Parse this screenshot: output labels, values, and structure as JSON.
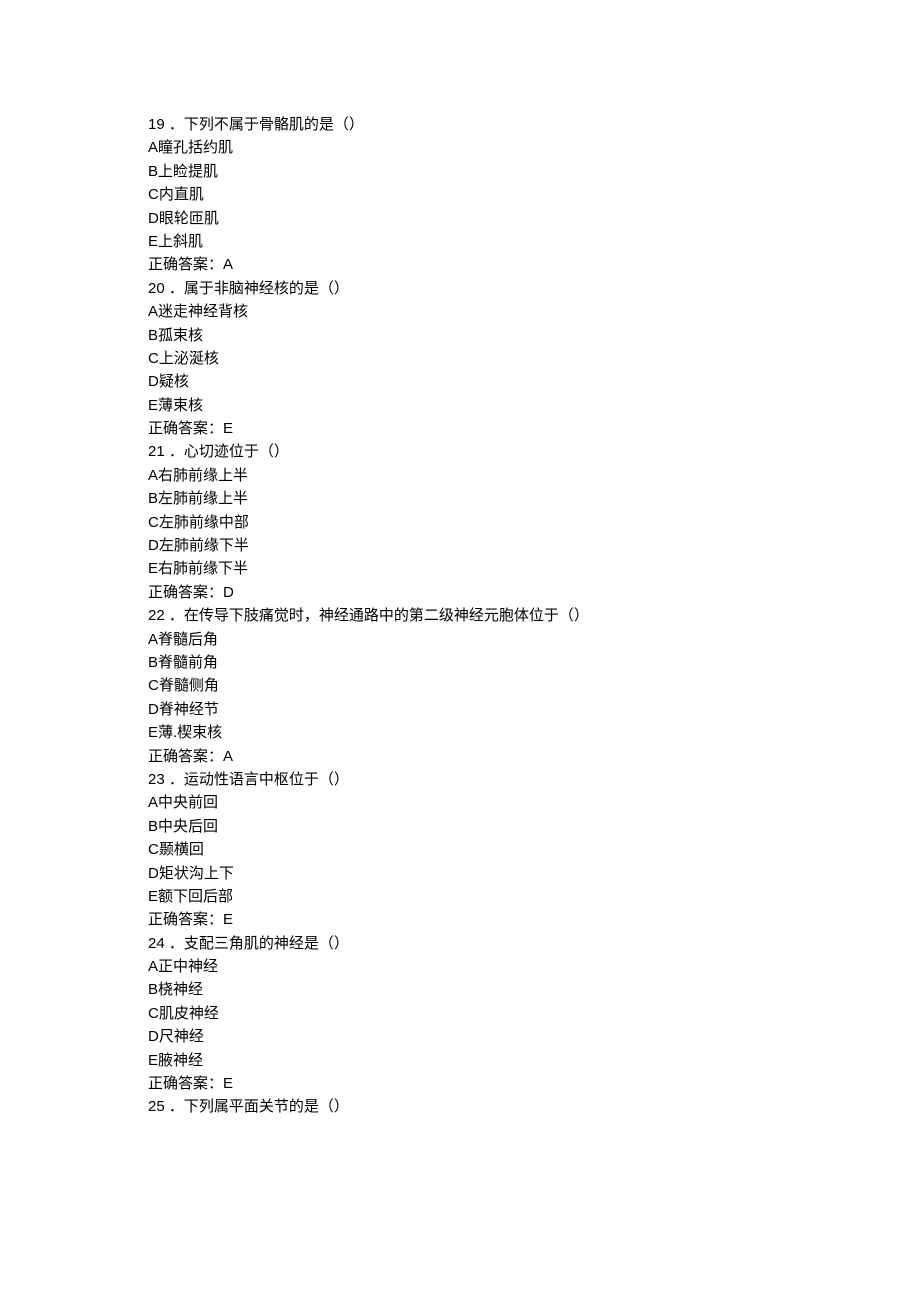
{
  "questions": [
    {
      "number": "19",
      "separator": " ．",
      "text": "下列不属于骨骼肌的是（）",
      "options": [
        {
          "label": "A",
          "text": "瞳孔括约肌"
        },
        {
          "label": "B",
          "text": "上睑提肌"
        },
        {
          "label": "C",
          "text": "内直肌"
        },
        {
          "label": "D",
          "text": "眼轮匝肌"
        },
        {
          "label": "E",
          "text": "上斜肌"
        }
      ],
      "answer_prefix": "正确答案：",
      "answer": "A"
    },
    {
      "number": "20",
      "separator": " ．",
      "text": "属于非脑神经核的是（）",
      "options": [
        {
          "label": "A",
          "text": "迷走神经背核"
        },
        {
          "label": "B",
          "text": "孤束核"
        },
        {
          "label": "C",
          "text": "上泌涎核"
        },
        {
          "label": "D",
          "text": "疑核"
        },
        {
          "label": "E",
          "text": "薄束核"
        }
      ],
      "answer_prefix": "正确答案：",
      "answer": "E"
    },
    {
      "number": "21",
      "separator": " ．",
      "text": "心切迹位于（）",
      "options": [
        {
          "label": "A",
          "text": "右肺前缘上半"
        },
        {
          "label": "B",
          "text": "左肺前缘上半"
        },
        {
          "label": "C",
          "text": "左肺前缘中部"
        },
        {
          "label": "D",
          "text": "左肺前缘下半"
        },
        {
          "label": "E",
          "text": "右肺前缘下半"
        }
      ],
      "answer_prefix": "正确答案：",
      "answer": "D"
    },
    {
      "number": "22",
      "separator": " ．",
      "text": "在传导下肢痛觉时，神经通路中的第二级神经元胞体位于（）",
      "options": [
        {
          "label": "A",
          "text": "脊髓后角"
        },
        {
          "label": "B",
          "text": "脊髓前角"
        },
        {
          "label": "C",
          "text": "脊髓侧角"
        },
        {
          "label": "D",
          "text": "脊神经节"
        },
        {
          "label": "E",
          "text": "薄.楔束核"
        }
      ],
      "answer_prefix": "正确答案：",
      "answer": "A"
    },
    {
      "number": "23",
      "separator": " ．",
      "text": "运动性语言中枢位于（）",
      "options": [
        {
          "label": "A",
          "text": "中央前回"
        },
        {
          "label": "B",
          "text": "中央后回"
        },
        {
          "label": "C",
          "text": "颞横回"
        },
        {
          "label": "D",
          "text": "矩状沟上下"
        },
        {
          "label": "E",
          "text": "额下回后部"
        }
      ],
      "answer_prefix": "正确答案：",
      "answer": "E"
    },
    {
      "number": "24",
      "separator": " ．",
      "text": "支配三角肌的神经是（）",
      "options": [
        {
          "label": "A",
          "text": "正中神经"
        },
        {
          "label": "B",
          "text": "桡神经"
        },
        {
          "label": "C",
          "text": "肌皮神经"
        },
        {
          "label": "D",
          "text": "尺神经"
        },
        {
          "label": "E",
          "text": "腋神经"
        }
      ],
      "answer_prefix": "正确答案：",
      "answer": "E"
    },
    {
      "number": "25",
      "separator": " ．",
      "text": "下列属平面关节的是（）",
      "options": [],
      "answer_prefix": "",
      "answer": ""
    }
  ]
}
